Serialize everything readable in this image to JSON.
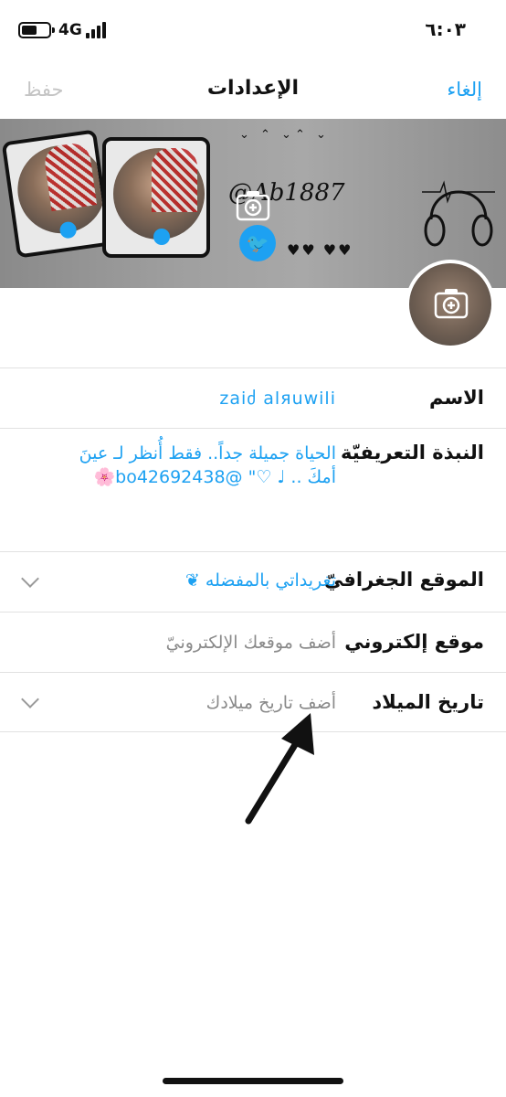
{
  "status_bar": {
    "network": "4G",
    "time": "٦:٠٣"
  },
  "nav": {
    "cancel_label": "إلغاء",
    "title": "الإعدادات",
    "save_label": "حفظ"
  },
  "banner": {
    "text": "@Ab1887"
  },
  "form": {
    "name": {
      "label": "الاسم",
      "value": "zaiძ alяuwili"
    },
    "bio": {
      "label": "النبذة التعريفيّة",
      "value": "الحياة جميلة جداً.. فقط أُنظر لـ عينَ أمكَ .. ♩ ♡\" @bo42692438🌸"
    },
    "location": {
      "label": "الموقع الجغرافيّ",
      "value": "تغريداتي بالمفضله ❦"
    },
    "website": {
      "label": "موقع إلكتروني",
      "placeholder": "أضف موقعك الإلكترونيّ"
    },
    "birthday": {
      "label": "تاريخ الميلاد",
      "placeholder": "أضف تاريخ ميلادك"
    }
  },
  "colors": {
    "accent": "#1da1f2",
    "disabled": "#c4c4c4",
    "placeholder": "#8a8a8a"
  }
}
